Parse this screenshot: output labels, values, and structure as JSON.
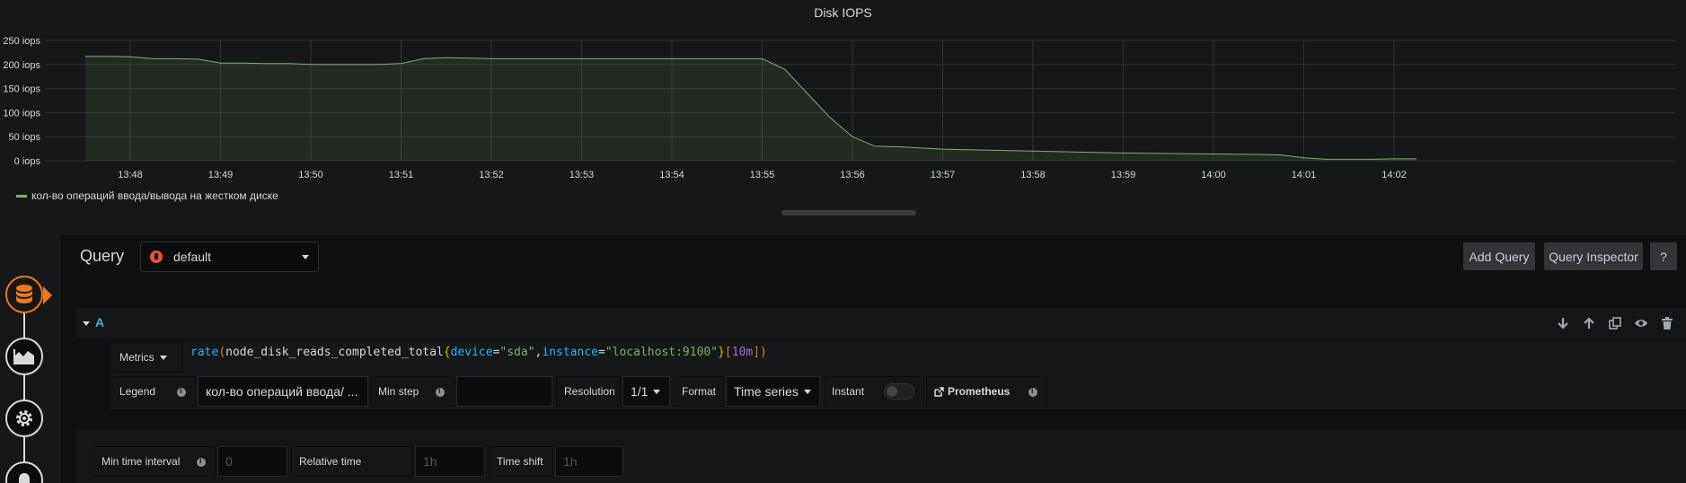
{
  "panel": {
    "title": "Disk IOPS",
    "legend": "кол-во операций ввода/вывода на жестком диске"
  },
  "chart_data": {
    "type": "area",
    "title": "Disk IOPS",
    "xlabel": "",
    "ylabel": "",
    "ylim": [
      0,
      250
    ],
    "yticks": [
      "0 iops",
      "50 iops",
      "100 iops",
      "150 iops",
      "200 iops",
      "250 iops"
    ],
    "xticks": [
      "13:48",
      "13:49",
      "13:50",
      "13:51",
      "13:52",
      "13:53",
      "13:54",
      "13:55",
      "13:56",
      "13:57",
      "13:58",
      "13:59",
      "14:00",
      "14:01",
      "14:02"
    ],
    "grid": true,
    "legend_position": "bottom-left",
    "series": [
      {
        "name": "кол-во операций ввода/вывода на жестком диске",
        "color": "#7eb26d",
        "x": [
          "13:47:30",
          "13:47:45",
          "13:48",
          "13:48:15",
          "13:48:30",
          "13:48:45",
          "13:49",
          "13:49:15",
          "13:49:30",
          "13:49:45",
          "13:50",
          "13:50:15",
          "13:50:30",
          "13:50:45",
          "13:51",
          "13:51:15",
          "13:51:30",
          "13:51:45",
          "13:52",
          "13:52:30",
          "13:53",
          "13:53:30",
          "13:54",
          "13:54:30",
          "13:55",
          "13:55:15",
          "13:55:30",
          "13:55:45",
          "13:56",
          "13:56:15",
          "13:56:30",
          "13:57",
          "13:57:30",
          "13:58",
          "13:58:30",
          "13:59",
          "13:59:30",
          "14:00",
          "14:00:30",
          "14:00:45",
          "14:01",
          "14:01:15",
          "14:01:30",
          "14:01:45",
          "14:02",
          "14:02:15"
        ],
        "values": [
          217,
          217,
          216,
          212,
          212,
          211,
          203,
          203,
          202,
          202,
          200,
          200,
          200,
          200,
          202,
          212,
          214,
          213,
          212,
          212,
          212,
          212,
          212,
          212,
          212,
          190,
          140,
          90,
          50,
          30,
          29,
          24,
          22,
          20,
          18,
          16,
          15,
          14,
          13,
          12,
          6,
          3,
          3,
          3,
          4,
          4
        ]
      }
    ]
  },
  "rail": {
    "icons": [
      "database-icon",
      "chart-icon",
      "cog-icon",
      "bell-icon"
    ]
  },
  "query_header": {
    "title": "Query",
    "datasource": "default",
    "add_query": "Add Query",
    "query_inspector": "Query Inspector",
    "help": "?"
  },
  "query_row": {
    "letter": "A"
  },
  "metrics": {
    "label": "Metrics",
    "expr_parts": {
      "fn": "rate",
      "metric": "node_disk_reads_completed_total",
      "l1_name": "device",
      "l1_val": "\"sda\"",
      "l2_name": "instance",
      "l2_val": "\"localhost:9100\"",
      "duration": "10m"
    }
  },
  "options": {
    "legend_label": "Legend",
    "legend_value": "кол-во операций ввода/ ...",
    "min_step_label": "Min step",
    "min_step_value": "",
    "resolution_label": "Resolution",
    "resolution_value": "1/1",
    "format_label": "Format",
    "format_value": "Time series",
    "instant_label": "Instant",
    "instant_on": false,
    "prometheus_link": "Prometheus"
  },
  "query_options": {
    "min_interval_label": "Min time interval",
    "min_interval_placeholder": "0",
    "relative_time_label": "Relative time",
    "relative_time_placeholder": "1h",
    "time_shift_label": "Time shift",
    "time_shift_placeholder": "1h"
  }
}
